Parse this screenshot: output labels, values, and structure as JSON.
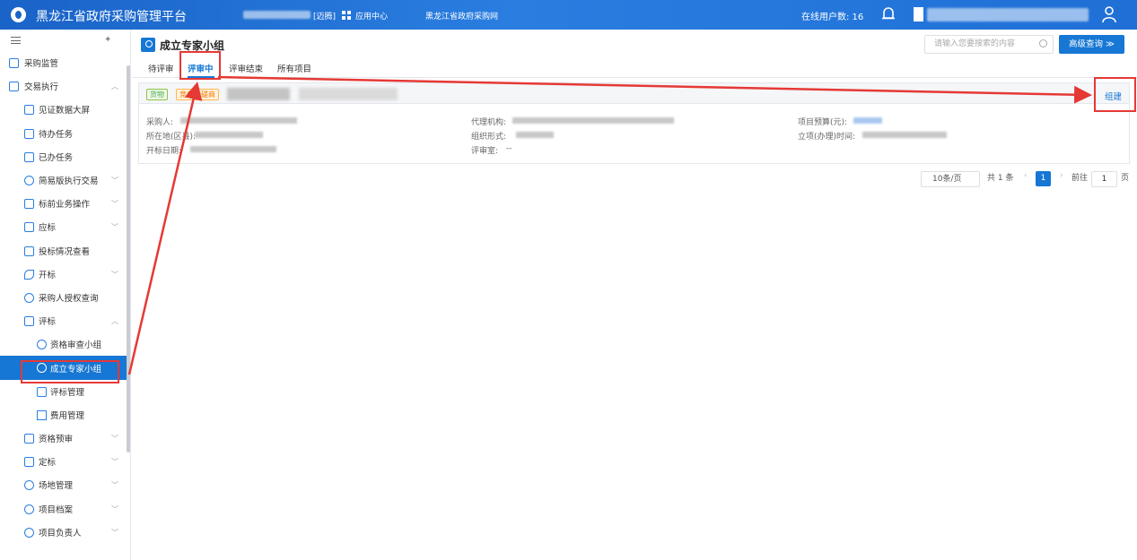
{
  "header": {
    "app_title": "黑龙江省政府采购管理平台",
    "version_tag": "[迈腾]",
    "app_center": "应用中心",
    "portal_link": "黑龙江省政府采购网",
    "online_label": "在线用户数: 16"
  },
  "sidebar": {
    "items": [
      {
        "label": "采购监管"
      },
      {
        "label": "交易执行"
      },
      {
        "label": "见证数据大屏"
      },
      {
        "label": "待办任务"
      },
      {
        "label": "已办任务"
      },
      {
        "label": "简易版执行交易"
      },
      {
        "label": "标前业务操作"
      },
      {
        "label": "应标"
      },
      {
        "label": "投标情况查看"
      },
      {
        "label": "开标"
      },
      {
        "label": "采购人授权查询"
      },
      {
        "label": "评标"
      },
      {
        "label": "资格审查小组"
      },
      {
        "label": "成立专家小组"
      },
      {
        "label": "评标管理"
      },
      {
        "label": "费用管理"
      },
      {
        "label": "资格预审"
      },
      {
        "label": "定标"
      },
      {
        "label": "场地管理"
      },
      {
        "label": "项目档案"
      },
      {
        "label": "项目负责人"
      }
    ]
  },
  "main": {
    "page_title": "成立专家小组",
    "search_placeholder": "请输入您要搜索的内容",
    "advanced_search": "高级查询 ≫",
    "tabs": [
      {
        "label": "待评审"
      },
      {
        "label": "评审中"
      },
      {
        "label": "评审结束"
      },
      {
        "label": "所有项目"
      }
    ],
    "card": {
      "tag_goods": "货物",
      "tag_method": "竞争性磋商",
      "build_action": "组建",
      "purchaser_label": "采购人:",
      "location_label": "所在地(区县):",
      "bid_open_date_label": "开标日期:",
      "agency_label": "代理机构:",
      "org_form_label": "组织形式:",
      "review_room_label": "评审室:",
      "review_room_value": "--",
      "budget_label": "项目预算(元):",
      "approval_time_label": "立项(办理)时间:"
    },
    "pagination": {
      "page_size": "10条/页",
      "total": "共 1 条",
      "current_page": "1",
      "goto_label": "前往",
      "goto_value": "1",
      "page_suffix": "页"
    }
  },
  "colors": {
    "primary": "#1677d4",
    "annotation_red": "#e53935"
  }
}
